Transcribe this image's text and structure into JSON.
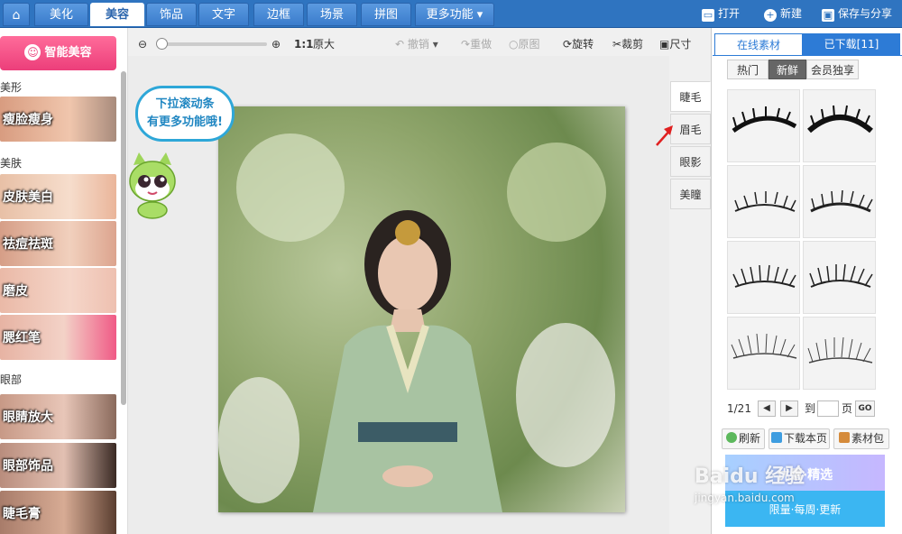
{
  "nav": {
    "tabs": [
      {
        "label": "⌂",
        "icon": "home-icon"
      },
      {
        "label": "美化"
      },
      {
        "label": "美容"
      },
      {
        "label": "饰品"
      },
      {
        "label": "文字"
      },
      {
        "label": "边框"
      },
      {
        "label": "场景"
      },
      {
        "label": "拼图"
      },
      {
        "label": "更多功能 ▾"
      }
    ],
    "active_index": 2,
    "open": "打开",
    "new": "新建",
    "save_share": "保存与分享"
  },
  "sidebar": {
    "beauty_button": "智能美容",
    "sections": [
      {
        "title": "美形",
        "items": [
          "瘦脸瘦身"
        ]
      },
      {
        "title": "美肤",
        "items": [
          "皮肤美白",
          "祛痘祛斑",
          "磨皮",
          "腮红笔"
        ]
      },
      {
        "title": "眼部",
        "items": [
          "眼睛放大",
          "眼部饰品",
          "睫毛膏"
        ]
      }
    ]
  },
  "toolbar": {
    "ratio": "1:1",
    "original_size": "原大",
    "undo": "撤销",
    "redo": "重做",
    "original": "原图",
    "rotate": "旋转",
    "crop": "裁剪",
    "size": "尺寸"
  },
  "canvas": {
    "bubble_line1": "下拉滚动条",
    "bubble_line2": "有更多功能哦!"
  },
  "side_tabs": [
    "睫毛",
    "眉毛",
    "眼影",
    "美瞳"
  ],
  "side_tab_active": 0,
  "right_panel": {
    "tab_online": "在线素材",
    "tab_downloaded": "已下载[11]",
    "sub_tabs": [
      "热门",
      "新鲜",
      "会员独享"
    ],
    "sub_tab_active": 1,
    "page": "1/21",
    "goto_label": "到",
    "page_unit": "页",
    "go": "GO",
    "refresh": "刷新",
    "download_page": "下载本页",
    "material_pack": "素材包",
    "banner_top": "优惠·精选",
    "banner_bottom": "限量·每周·更新"
  },
  "watermark": {
    "line1": "Baidu 经验",
    "line2": "jingyan.baidu.com"
  },
  "colors": {
    "nav_blue": "#2f74c0",
    "beauty_pink": "#ec3e7a",
    "panel_tab_blue": "#2d7bd6",
    "bubble_blue": "#2ea7d8"
  }
}
